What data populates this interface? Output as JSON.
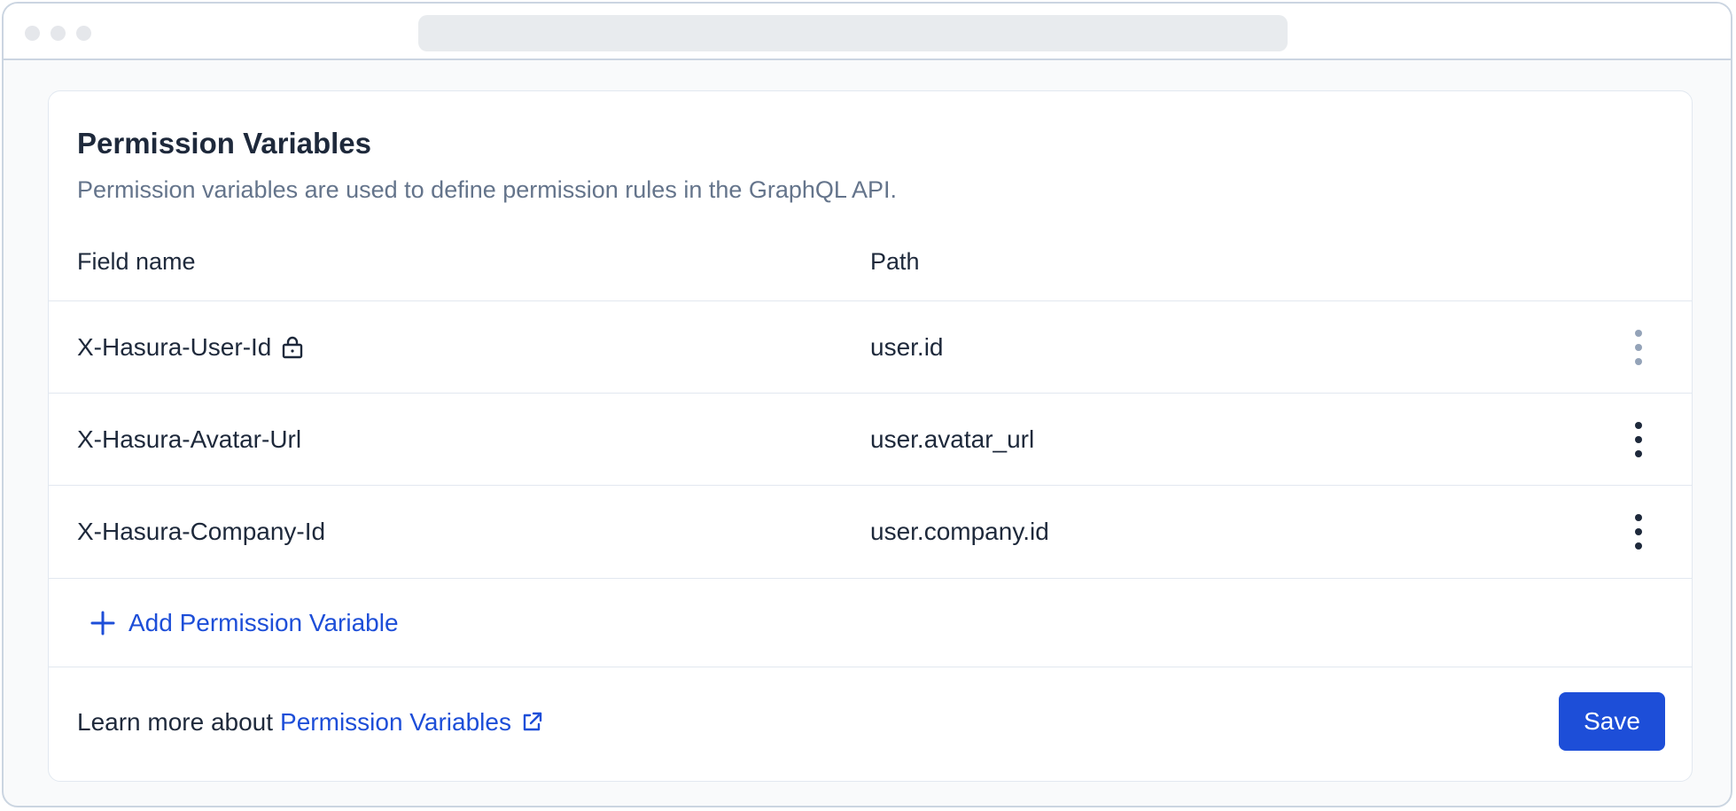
{
  "card": {
    "title": "Permission Variables",
    "description": "Permission variables are used to define permission rules in the GraphQL API."
  },
  "table": {
    "headers": [
      "Field name",
      "Path"
    ],
    "rows": [
      {
        "field": "X-Hasura-User-Id",
        "path": "user.id",
        "locked": true
      },
      {
        "field": "X-Hasura-Avatar-Url",
        "path": "user.avatar_url",
        "locked": false
      },
      {
        "field": "X-Hasura-Company-Id",
        "path": "user.company.id",
        "locked": false
      }
    ]
  },
  "add_button_label": "Add Permission Variable",
  "footer": {
    "learn_prefix": "Learn more about",
    "learn_link": "Permission Variables",
    "save_label": "Save"
  },
  "colors": {
    "accent": "#1d4ed8",
    "text": "#1e293b",
    "muted": "#64748b"
  }
}
